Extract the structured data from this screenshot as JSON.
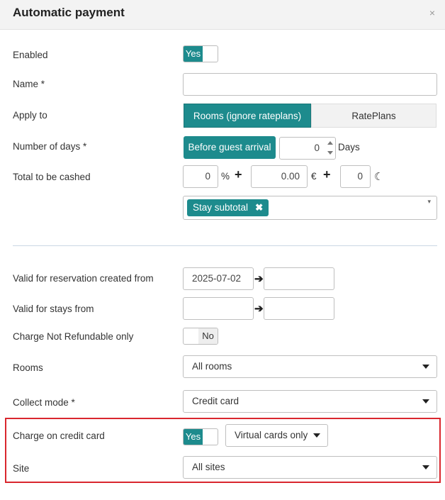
{
  "modal": {
    "title": "Automatic payment",
    "close_icon": "×"
  },
  "form": {
    "enabled": {
      "label": "Enabled",
      "toggle": "Yes"
    },
    "name": {
      "label": "Name *",
      "value": ""
    },
    "apply_to": {
      "label": "Apply to",
      "options": [
        "Rooms (ignore rateplans)",
        "RatePlans"
      ],
      "selected": "Rooms (ignore rateplans)"
    },
    "number_of_days": {
      "label": "Number of days *",
      "mode": "Before guest arrival",
      "value": "0",
      "unit": "Days"
    },
    "total_to_be_cashed": {
      "label": "Total to be cashed",
      "percent": "0",
      "percent_symbol": "%",
      "amount": "0.00",
      "currency": "€",
      "nights": "0",
      "nights_icon": "moon-icon",
      "tag": "Stay subtotal"
    },
    "valid_reservation": {
      "label": "Valid for reservation created from",
      "from": "2025-07-02",
      "to": ""
    },
    "valid_stays": {
      "label": "Valid for stays from",
      "from": "",
      "to": ""
    },
    "non_refundable": {
      "label": "Charge Not Refundable only",
      "toggle": "No"
    },
    "rooms": {
      "label": "Rooms",
      "value": "All rooms"
    },
    "collect_mode": {
      "label": "Collect mode *",
      "value": "Credit card"
    },
    "charge_credit_card": {
      "label": "Charge on credit card",
      "toggle": "Yes",
      "card_type": "Virtual cards only"
    },
    "site": {
      "label": "Site",
      "value": "All sites"
    }
  },
  "colors": {
    "accent": "#1d8b8d",
    "highlight": "#d9272e"
  }
}
